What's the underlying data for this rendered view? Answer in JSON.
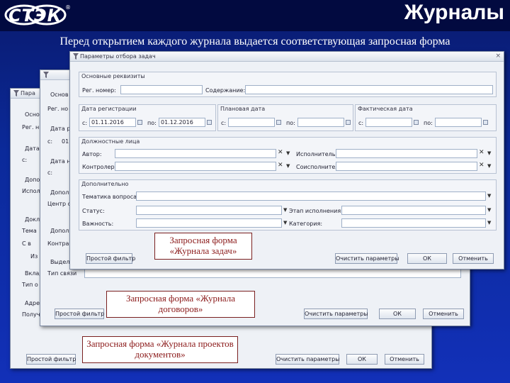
{
  "header": {
    "logo_text": "СТЭК",
    "reg_mark": "®",
    "title": "Журналы"
  },
  "subtitle": "Перед открытием каждого журнала выдается соответствующая запросная форма",
  "dialog_front": {
    "title": "Параметры отбора задач",
    "close": "×",
    "group_main": "Основные реквизиты",
    "reg_no_label": "Рег. номер:",
    "content_label": "Содержание:",
    "group_reg_date": "Дата регистрации",
    "from_label": "с:",
    "to_label": "по:",
    "reg_from": "01.11.2016",
    "reg_to": "01.12.2016",
    "group_plan_date": "Плановая дата",
    "group_fact_date": "Фактическая дата",
    "group_persons": "Должностные лица",
    "author_label": "Автор:",
    "executor_label": "Исполнитель:",
    "controller_label": "Контролер:",
    "coexecutor_label": "Соисполнитель:",
    "group_extra": "Дополнительно",
    "topic_label": "Тематика вопроса:",
    "status_label": "Статус:",
    "stage_label": "Этап исполнения:",
    "importance_label": "Важность:",
    "category_label": "Категория:",
    "simple_filter": "Простой фильтр",
    "clear_params": "Очистить параметры",
    "ok": "ОК",
    "cancel": "Отменить"
  },
  "dialog_middle": {
    "lbl_main": "Основ",
    "lbl_reg": "Рег. но",
    "lbl_date": "Дата ре",
    "lbl_from": "с:",
    "lbl_date_val": "01.",
    "lbl_date2": "Дата н",
    "lbl_from2": "с:",
    "lbl_extra": "Допол",
    "lbl_center": "Центр о",
    "lbl_extra2": "Допол",
    "lbl_contract": "Контра",
    "lbl_selected": "Выдел",
    "lbl_type": "Тип связи",
    "simple_filter": "Простой фильтр",
    "clear_params": "Очистить параметры",
    "ok": "ОК",
    "cancel": "Отменить"
  },
  "dialog_back": {
    "lbl_title": "Пара",
    "lbl_main": "Осно",
    "lbl_reg": "Рег. н",
    "lbl_date": "Дата",
    "lbl_from": "с:",
    "lbl_extra": "Допол",
    "lbl_exec": "Испол",
    "lbl_doc": "Докл",
    "lbl_topic": "Тема",
    "lbl_sv": "С в",
    "lbl_iz": "Из",
    "lbl_incl": "Вклад",
    "lbl_type": "Тип о",
    "lbl_addr": "Адре",
    "lbl_recip": "Получ",
    "simple_filter": "Простой фильтр",
    "clear_params": "Очистить параметры",
    "ok": "ОК",
    "cancel": "Отменить"
  },
  "callouts": {
    "tasks": "Запросная форма «Журнала задач»",
    "contracts": "Запросная форма «Журнала договоров»",
    "drafts": "Запросная форма «Журнала проектов документов»"
  }
}
